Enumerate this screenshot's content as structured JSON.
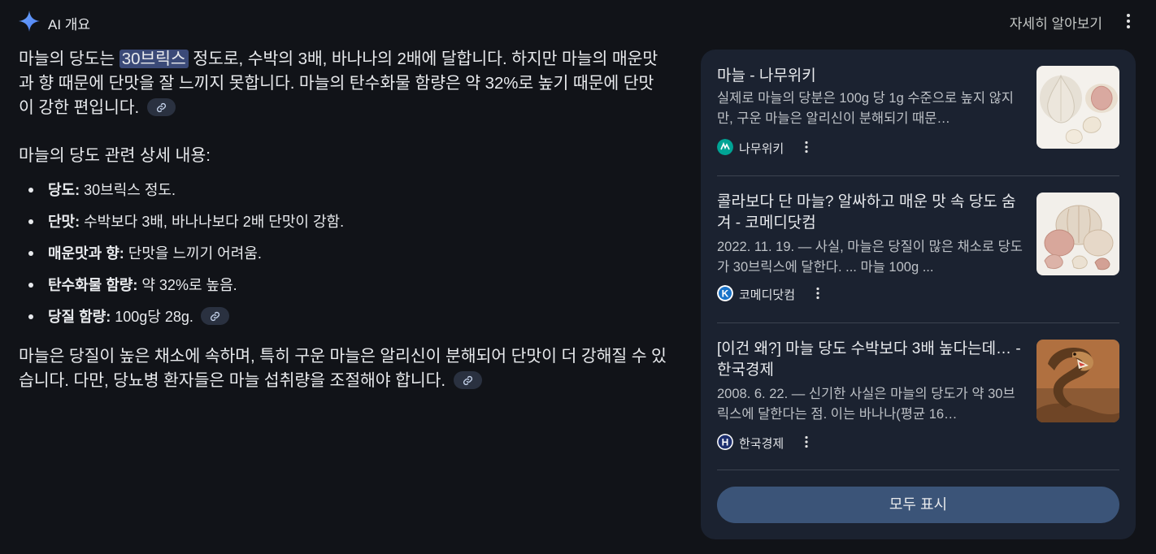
{
  "header": {
    "title": "AI 개요",
    "learn_more": "자세히 알아보기"
  },
  "overview": {
    "para1_pre": "마늘의 당도는 ",
    "para1_highlight": "30브릭스",
    "para1_post": " 정도로, 수박의 3배, 바나나의 2배에 달합니다. 하지만 마늘의 매운맛과 향 때문에 단맛을 잘 느끼지 못합니다. 마늘의 탄수화물 함량은 약 32%로 높기 때문에 단맛이 강한 편입니다.",
    "section_title": "마늘의 당도 관련 상세 내용:",
    "details": [
      {
        "label": "당도:",
        "text": " 30브릭스 정도."
      },
      {
        "label": "단맛:",
        "text": " 수박보다 3배, 바나나보다 2배 단맛이 강함."
      },
      {
        "label": "매운맛과 향:",
        "text": " 단맛을 느끼기 어려움."
      },
      {
        "label": "탄수화물 함량:",
        "text": " 약 32%로 높음."
      },
      {
        "label": "당질 함량:",
        "text": " 100g당 28g."
      }
    ],
    "para2": "마늘은 당질이 높은 채소에 속하며, 특히 구운 마늘은 알리신이 분해되어 단맛이 더 강해질 수 있습니다. 다만, 당뇨병 환자들은 마늘 섭취량을 조절해야 합니다."
  },
  "sources": [
    {
      "title": "마늘 - 나무위키",
      "snippet": "실제로 마늘의 당분은 100g 당 1g 수준으로 높지 않지만, 구운 마늘은 알리신이 분해되기 때문…",
      "site": "나무위키",
      "thumb": "garlic-cloves-image"
    },
    {
      "title": "콜라보다 단 마늘? 알싸하고 매운 맛 속 당도 숨겨 - 코메디닷컴",
      "snippet": "2022. 11. 19. — 사실, 마늘은 당질이 많은 채소로 당도가 30브릭스에 달한다. ... 마늘 100g ...",
      "site": "코메디닷컴",
      "thumb": "garlic-bulbs-image"
    },
    {
      "title": "[이건 왜?] 마늘 당도 수박보다 3배 높다는데… - 한국경제",
      "snippet": "2008. 6. 22. — 신기한 사실은 마늘의 당도가 약 30브릭스에 달한다는 점. 이는 바나나(평균 16…",
      "site": "한국경제",
      "thumb": "cobra-image"
    }
  ],
  "show_all": "모두 표시",
  "colors": {
    "background": "#111318",
    "panel": "#1b2230",
    "highlight": "#3b4a78",
    "button": "#3b5478"
  }
}
